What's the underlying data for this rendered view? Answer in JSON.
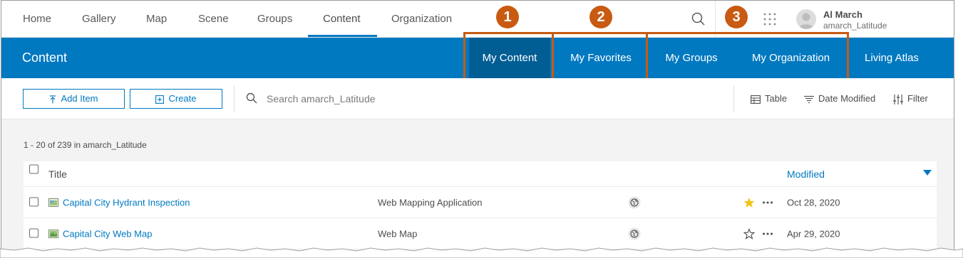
{
  "nav": {
    "items": [
      {
        "label": "Home"
      },
      {
        "label": "Gallery"
      },
      {
        "label": "Map"
      },
      {
        "label": "Scene"
      },
      {
        "label": "Groups"
      },
      {
        "label": "Content"
      },
      {
        "label": "Organization"
      }
    ],
    "active": "Content",
    "user": {
      "name": "Al March",
      "username": "amarch_Latitude"
    }
  },
  "header": {
    "title": "Content",
    "tabs": [
      {
        "label": "My Content"
      },
      {
        "label": "My Favorites"
      },
      {
        "label": "My Groups"
      },
      {
        "label": "My Organization"
      },
      {
        "label": "Living Atlas"
      }
    ],
    "active_tab": "My Content"
  },
  "callouts": [
    "1",
    "2",
    "3"
  ],
  "toolbar": {
    "add_item_label": "Add Item",
    "create_label": "Create",
    "search_placeholder": "Search amarch_Latitude",
    "view_label": "Table",
    "sort_label": "Date Modified",
    "filter_label": "Filter"
  },
  "results": {
    "count_text": "1 - 20 of 239 in amarch_Latitude",
    "columns": {
      "title": "Title",
      "modified": "Modified"
    },
    "rows": [
      {
        "title": "Capital City Hydrant Inspection",
        "type": "Web Mapping Application",
        "favorite": true,
        "modified": "Oct 28, 2020",
        "icon": "web-app-icon"
      },
      {
        "title": "Capital City Web Map",
        "type": "Web Map",
        "favorite": false,
        "modified": "Apr 29, 2020",
        "icon": "web-map-icon"
      }
    ]
  },
  "colors": {
    "brand_blue": "#0079c1",
    "active_tab_blue": "#005e95",
    "callout_orange": "#c85a11",
    "favorite_yellow": "#f0c419"
  }
}
